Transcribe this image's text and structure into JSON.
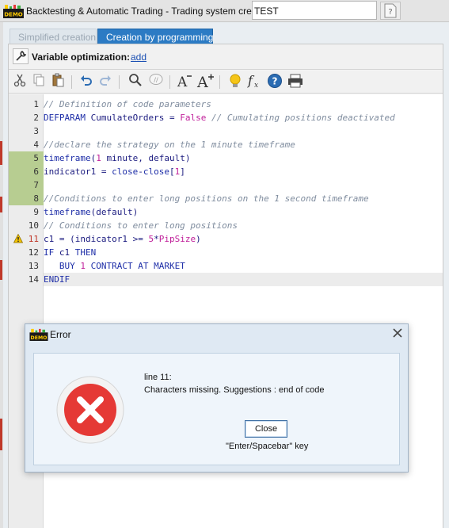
{
  "window": {
    "title": "Backtesting & Automatic Trading - Trading system creation",
    "name_value": "TEST",
    "logo_text": "DEMO"
  },
  "tabs": [
    {
      "label": "Simplified creation",
      "active": false
    },
    {
      "label": "Creation by programming",
      "active": true
    }
  ],
  "variable_optimization": {
    "label": "Variable optimization:",
    "add_link": "add"
  },
  "toolbar": {
    "icons": [
      "cut-icon",
      "copy-icon",
      "paste-icon",
      "undo-icon",
      "redo-icon",
      "search-icon",
      "comment-icon",
      "font-decrease-icon",
      "font-increase-icon",
      "bulb-icon",
      "function-icon",
      "help-icon",
      "print-icon"
    ]
  },
  "editor": {
    "lines": [
      {
        "n": "1",
        "parts": [
          [
            "c",
            "// Definition of code parameters"
          ]
        ]
      },
      {
        "n": "2",
        "parts": [
          [
            "k",
            "DEFPARAM "
          ],
          [
            "t",
            "CumulateOrders"
          ],
          [
            "t",
            " = "
          ],
          [
            "l",
            "False"
          ],
          [
            "c",
            " // Cumulating positions deactivated"
          ]
        ]
      },
      {
        "n": "3",
        "parts": []
      },
      {
        "n": "4",
        "parts": [
          [
            "c",
            "//declare the strategy on the 1 minute timeframe"
          ]
        ]
      },
      {
        "n": "5",
        "parts": [
          [
            "k",
            "timeframe"
          ],
          [
            "t",
            "("
          ],
          [
            "l",
            "1"
          ],
          [
            "t",
            " minute, default)"
          ]
        ]
      },
      {
        "n": "6",
        "parts": [
          [
            "t",
            "indicator1 = "
          ],
          [
            "k",
            "close"
          ],
          [
            "t",
            "-"
          ],
          [
            "k",
            "close"
          ],
          [
            "t",
            "["
          ],
          [
            "l",
            "1"
          ],
          [
            "t",
            "]"
          ]
        ]
      },
      {
        "n": "7",
        "parts": []
      },
      {
        "n": "8",
        "parts": [
          [
            "c",
            "//Conditions to enter long positions on the 1 second timeframe"
          ]
        ]
      },
      {
        "n": "9",
        "parts": [
          [
            "k",
            "timeframe"
          ],
          [
            "t",
            "(default)"
          ]
        ]
      },
      {
        "n": "10",
        "parts": [
          [
            "c",
            "// Conditions to enter long positions"
          ]
        ]
      },
      {
        "n": "11",
        "parts": [
          [
            "t",
            "c1 = (indicator1 >= "
          ],
          [
            "l",
            "5"
          ],
          [
            "t",
            "*"
          ],
          [
            "l",
            "PipSize"
          ],
          [
            "t",
            ")"
          ]
        ]
      },
      {
        "n": "12",
        "parts": [
          [
            "k",
            "IF"
          ],
          [
            "t",
            " c1 "
          ],
          [
            "k",
            "THEN"
          ]
        ]
      },
      {
        "n": "13",
        "parts": [
          [
            "t",
            "   "
          ],
          [
            "k",
            "BUY "
          ],
          [
            "l",
            "1"
          ],
          [
            "k",
            " CONTRACT AT MARKET"
          ]
        ]
      },
      {
        "n": "14",
        "parts": [
          [
            "k",
            "ENDIF"
          ]
        ]
      }
    ],
    "modified_lines": [
      5,
      6,
      7,
      8
    ],
    "warning_line": 11,
    "current_line": 14
  },
  "dialog": {
    "title": "Error",
    "line": "line 11:",
    "message": "Characters missing. Suggestions : end of code",
    "button_label": "Close",
    "hint": "\"Enter/Spacebar\" key"
  },
  "colors": {
    "tab_active": "#2c7bc4",
    "comment": "#7f8c9e",
    "keyword": "#1f2fa8",
    "literal": "#c0209a",
    "modified_gutter": "#b7cd91",
    "error_red": "#e53935"
  }
}
